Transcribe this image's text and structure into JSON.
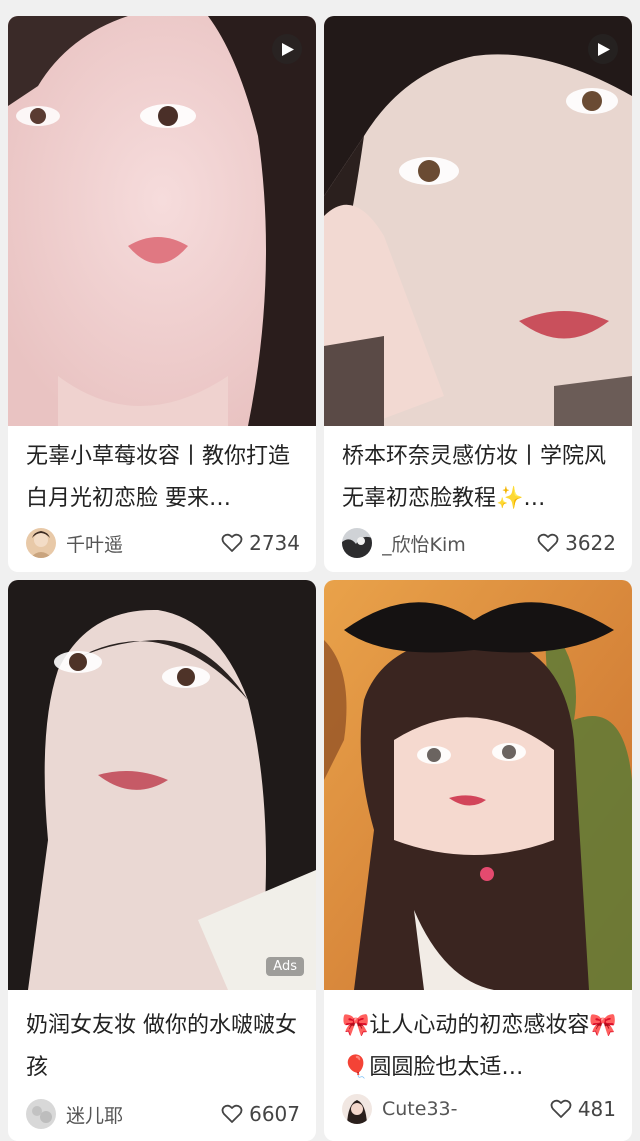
{
  "feed": {
    "cards": [
      {
        "title": "无辜小草莓妆容丨教你打造白月光初恋脸 要来…",
        "author": "千叶遥",
        "likes": "2734",
        "has_video": true
      },
      {
        "title": "桥本环奈灵感仿妆丨学院风无辜初恋脸教程✨…",
        "author": "_欣怡Kim",
        "likes": "3622",
        "has_video": true
      },
      {
        "title": "奶润女友妆 做你的水啵啵女孩",
        "author": "迷儿耶",
        "likes": "6607",
        "ads_label": "Ads"
      },
      {
        "title": "🎀让人心动的初恋感妆容🎀 🎈圆圆脸也太适…",
        "author": "Cute33-",
        "likes": "481"
      }
    ]
  },
  "colors": {
    "background": "#f0f0f0",
    "card": "#ffffff",
    "text": "#222222",
    "muted": "#555555"
  },
  "icons": {
    "play": "play-icon",
    "like": "heart-outline-icon"
  }
}
